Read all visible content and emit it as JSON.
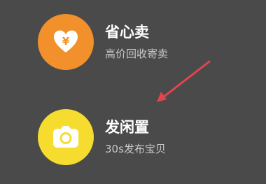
{
  "options": [
    {
      "title": "省心卖",
      "subtitle": "高价回收寄卖",
      "icon": "heart-yen-icon",
      "color": "#f2902b"
    },
    {
      "title": "发闲置",
      "subtitle": "30s发布宝贝",
      "icon": "camera-icon",
      "color": "#f5dc2f"
    }
  ],
  "annotation": {
    "icon": "red-arrow-icon",
    "color": "#e0454f"
  }
}
